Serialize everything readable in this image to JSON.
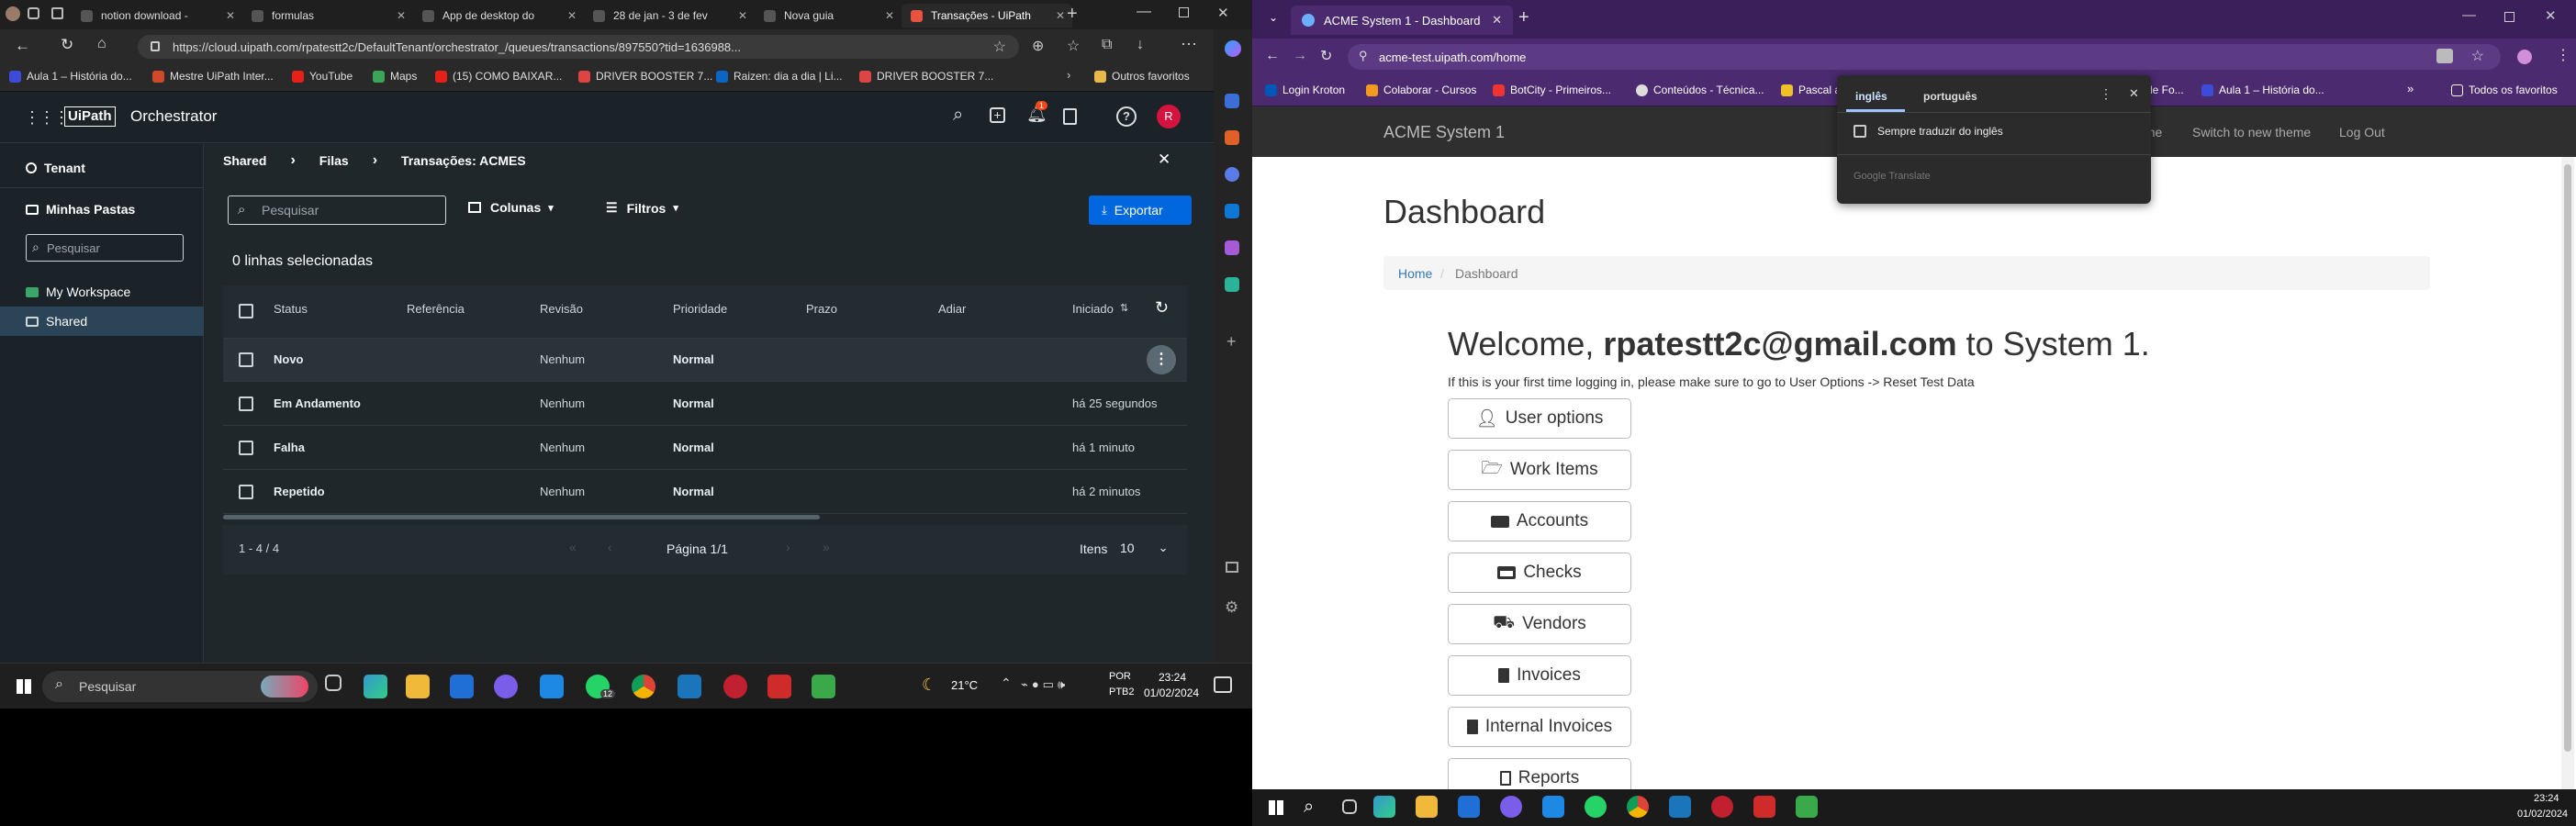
{
  "left_browser": {
    "tabs": [
      {
        "label": "notion download -"
      },
      {
        "label": "formulas"
      },
      {
        "label": "App de desktop do"
      },
      {
        "label": "28 de jan - 3 de fev"
      },
      {
        "label": "Nova guia"
      },
      {
        "label": "Transações - UiPath"
      }
    ],
    "url": "https://cloud.uipath.com/rpatestt2c/DefaultTenant/orchestrator_/queues/transactions/897550?tid=1636988...",
    "bookmarks": [
      "Aula 1 – História do...",
      "Mestre UiPath Inter...",
      "YouTube",
      "Maps",
      "(15) COMO BAIXAR...",
      "DRIVER BOOSTER 7...",
      "Raizen: dia a dia | Li...",
      "DRIVER BOOSTER 7...",
      "Outros favoritos"
    ]
  },
  "orchestrator": {
    "brand": "UiPath",
    "product": "Orchestrator",
    "avatar_letter": "R",
    "notification_count": "1",
    "sidebar": {
      "tenant": "Tenant",
      "my_folders": "Minhas Pastas",
      "search_placeholder": "Pesquisar",
      "items": [
        "My Workspace",
        "Shared"
      ]
    },
    "breadcrumb": [
      "Shared",
      "Filas",
      "Transações: ACMES"
    ],
    "toolbar": {
      "search_placeholder": "Pesquisar",
      "columns": "Colunas",
      "filters": "Filtros",
      "export": "Exportar"
    },
    "selected_text": "0 linhas selecionadas",
    "columns": [
      "Status",
      "Referência",
      "Revisão",
      "Prioridade",
      "Prazo",
      "Adiar",
      "Iniciado"
    ],
    "rows": [
      {
        "status": "Novo",
        "revisao": "Nenhum",
        "prioridade": "Normal",
        "iniciado": ""
      },
      {
        "status": "Em Andamento",
        "revisao": "Nenhum",
        "prioridade": "Normal",
        "iniciado": "há 25 segundos"
      },
      {
        "status": "Falha",
        "revisao": "Nenhum",
        "prioridade": "Normal",
        "iniciado": "há 1 minuto"
      },
      {
        "status": "Repetido",
        "revisao": "Nenhum",
        "prioridade": "Normal",
        "iniciado": "há 2 minutos"
      }
    ],
    "footer": {
      "range": "1 - 4 / 4",
      "page": "Página 1/1",
      "items_label": "Itens",
      "items_value": "10"
    }
  },
  "left_taskbar": {
    "search": "Pesquisar",
    "weather": "21°C",
    "lang1": "POR",
    "lang2": "PTB2",
    "time": "23:24",
    "date": "01/02/2024",
    "badge": "12"
  },
  "right_browser": {
    "tab_label": "ACME System 1 - Dashboard",
    "url": "acme-test.uipath.com/home",
    "bookmarks": [
      "Login Kroton",
      "Colaborar - Cursos",
      "BotCity - Primeiros...",
      "Conteúdos - Técnica...",
      "Pascal a",
      "le Fo...",
      "Aula 1 – História do...",
      "Todos os favoritos"
    ],
    "translate": {
      "lang_from": "inglês",
      "lang_to": "português",
      "always": "Sempre traduzir do inglês",
      "brand": "Google Translate"
    }
  },
  "acme": {
    "brand": "ACME System 1",
    "nav": [
      "Home",
      "Switch to new theme",
      "Log Out"
    ],
    "title": "Dashboard",
    "breadcrumb": [
      "Home",
      "Dashboard"
    ],
    "welcome_pre": "Welcome,",
    "welcome_email": "rpatestt2c@gmail.com",
    "welcome_post": "to System 1.",
    "hint": "If this is your first time logging in, please make sure to go to User Options -> Reset Test Data",
    "buttons": [
      "User options",
      "Work Items",
      "Accounts",
      "Checks",
      "Vendors",
      "Invoices",
      "Internal Invoices",
      "Reports"
    ]
  },
  "right_taskbar": {
    "time": "23:24",
    "date": "01/02/2024"
  }
}
